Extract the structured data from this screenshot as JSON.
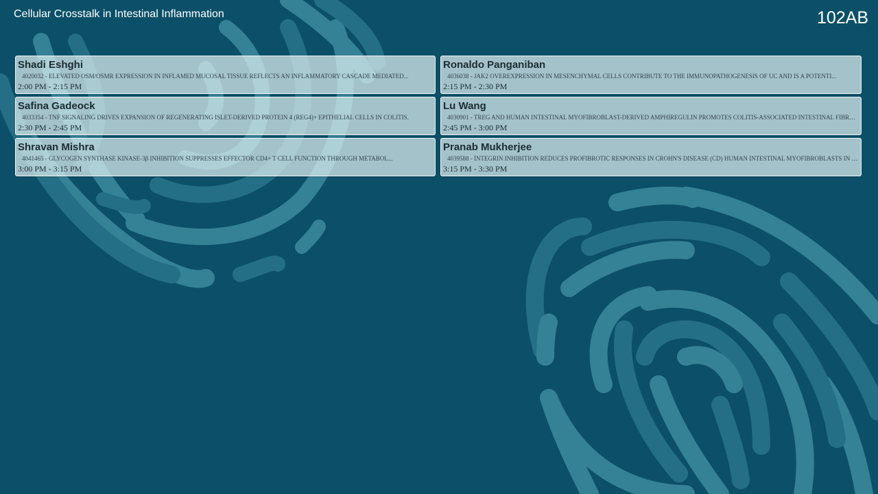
{
  "header": {
    "session_title": "Cellular Crosstalk in Intestinal Inflammation",
    "room": "102AB"
  },
  "presentations": [
    {
      "speaker": "Shadi Eshghi",
      "abstract": "4020032 - ELEVATED OSM/OSMR EXPRESSION IN INFLAMED MUCOSAL TISSUE REFLECTS AN INFLAMMATORY CASCADE MEDIATED...",
      "time": "2:00 PM - 2:15 PM"
    },
    {
      "speaker": "Ronaldo Panganiban",
      "abstract": "4036038 - JAK2 OVEREXPRESSION IN MESENCHYMAL CELLS CONTRIBUTE TO THE IMMUNOPATHOGENESIS OF UC AND IS A POTENTI...",
      "time": "2:15 PM - 2:30 PM"
    },
    {
      "speaker": "Safina Gadeock",
      "abstract": "4033354 - TNF SIGNALING DRIVES EXPANSION OF REGENERATING ISLET-DERIVED PROTEIN 4 (REG4)+ EPITHELIAL CELLS IN COLITIS.",
      "time": "2:30 PM - 2:45 PM"
    },
    {
      "speaker": "Lu Wang",
      "abstract": "4030901 - TREG AND HUMAN INTESTINAL MYOFIBROBLAST-DERIVED AMPHIREGULIN PROMOTES COLITIS-ASSOCIATED INTESTINAL FIBROS...",
      "time": "2:45 PM - 3:00 PM"
    },
    {
      "speaker": "Shravan Mishra",
      "abstract": "4041465 - GLYCOGEN SYNTHASE KINASE-3β INHIBITION SUPPRESSES EFFECTOR CD4+ T CELL FUNCTION THROUGH METABOL...",
      "time": "3:00 PM - 3:15 PM"
    },
    {
      "speaker": "Pranab Mukherjee",
      "abstract": "4039588 - INTEGRIN INHIBITION REDUCES PROFIBROTIC RESPONSES IN CROHN'S DISEASE (CD) HUMAN INTESTINAL MYOFIBROBLASTS IN VITR...",
      "time": "3:15 PM - 3:30 PM"
    }
  ],
  "colors": {
    "background": "#0b5068",
    "pattern_light": "#5fb3c4",
    "pattern_dark": "#3d8ea3",
    "card_background": "#deeef0"
  },
  "decorations": {
    "background_pattern": "fingerprint-swirl-pattern"
  }
}
